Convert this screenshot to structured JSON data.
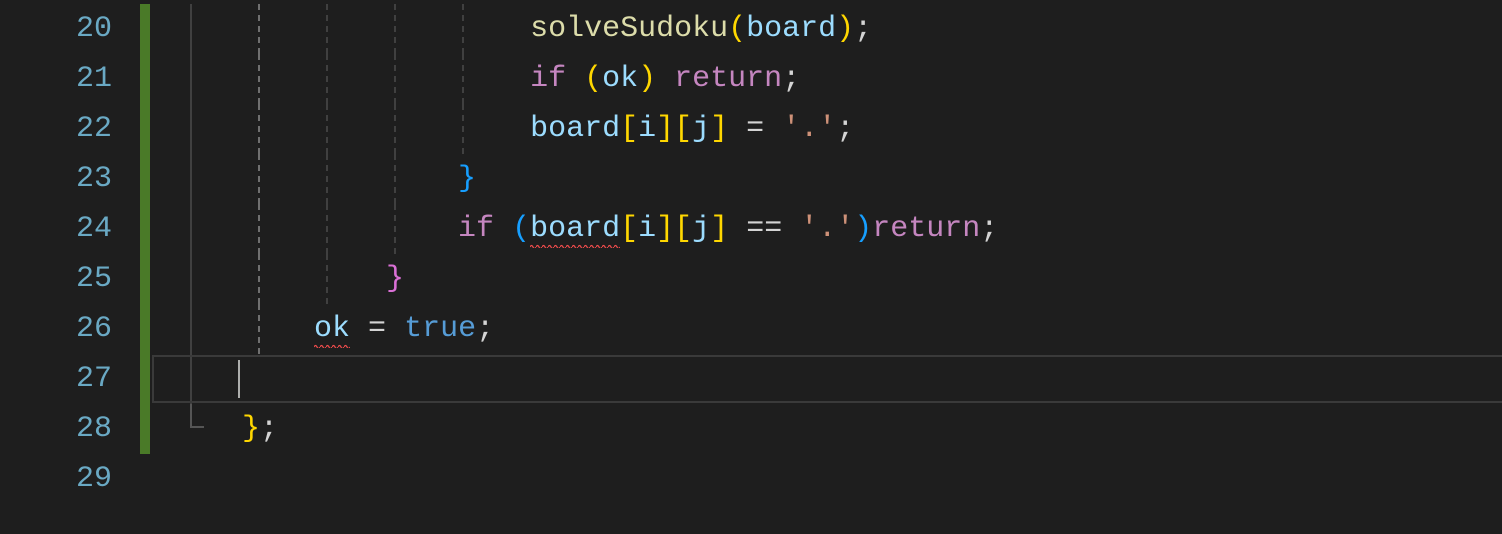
{
  "editor": {
    "language": "cpp",
    "currentLine": 27,
    "lines": [
      {
        "num": 20,
        "indent": 5,
        "guides": [
          0,
          1,
          2,
          3,
          4
        ],
        "activeGuide": 1,
        "tokens": [
          {
            "t": "solveSudoku",
            "c": "fn"
          },
          {
            "t": "(",
            "c": "paren-y"
          },
          {
            "t": "board",
            "c": "var"
          },
          {
            "t": ")",
            "c": "paren-y"
          },
          {
            "t": ";",
            "c": "punc"
          }
        ]
      },
      {
        "num": 21,
        "indent": 5,
        "guides": [
          0,
          1,
          2,
          3,
          4
        ],
        "activeGuide": 1,
        "tokens": [
          {
            "t": "if",
            "c": "kw"
          },
          {
            "t": " ",
            "c": "punc"
          },
          {
            "t": "(",
            "c": "paren-y"
          },
          {
            "t": "ok",
            "c": "var"
          },
          {
            "t": ")",
            "c": "paren-y"
          },
          {
            "t": " ",
            "c": "punc"
          },
          {
            "t": "return",
            "c": "kw"
          },
          {
            "t": ";",
            "c": "punc"
          }
        ]
      },
      {
        "num": 22,
        "indent": 5,
        "guides": [
          0,
          1,
          2,
          3,
          4
        ],
        "activeGuide": 1,
        "tokens": [
          {
            "t": "board",
            "c": "var"
          },
          {
            "t": "[",
            "c": "paren-y"
          },
          {
            "t": "i",
            "c": "var"
          },
          {
            "t": "]",
            "c": "paren-y"
          },
          {
            "t": "[",
            "c": "paren-y"
          },
          {
            "t": "j",
            "c": "var"
          },
          {
            "t": "]",
            "c": "paren-y"
          },
          {
            "t": " = ",
            "c": "punc"
          },
          {
            "t": "'.'",
            "c": "str"
          },
          {
            "t": ";",
            "c": "punc"
          }
        ]
      },
      {
        "num": 23,
        "indent": 4,
        "guides": [
          0,
          1,
          2,
          3
        ],
        "activeGuide": 1,
        "tokens": [
          {
            "t": "}",
            "c": "paren-b"
          }
        ]
      },
      {
        "num": 24,
        "indent": 4,
        "guides": [
          0,
          1,
          2,
          3
        ],
        "activeGuide": 1,
        "tokens": [
          {
            "t": "if",
            "c": "kw"
          },
          {
            "t": " ",
            "c": "punc"
          },
          {
            "t": "(",
            "c": "paren-b"
          },
          {
            "t": "board",
            "c": "var",
            "err": true
          },
          {
            "t": "[",
            "c": "paren-y"
          },
          {
            "t": "i",
            "c": "var"
          },
          {
            "t": "]",
            "c": "paren-y"
          },
          {
            "t": "[",
            "c": "paren-y"
          },
          {
            "t": "j",
            "c": "var"
          },
          {
            "t": "]",
            "c": "paren-y"
          },
          {
            "t": " == ",
            "c": "punc"
          },
          {
            "t": "'.'",
            "c": "str"
          },
          {
            "t": ")",
            "c": "paren-b"
          },
          {
            "t": "return",
            "c": "kw"
          },
          {
            "t": ";",
            "c": "punc"
          }
        ]
      },
      {
        "num": 25,
        "indent": 3,
        "guides": [
          0,
          1,
          2
        ],
        "activeGuide": 1,
        "tokens": [
          {
            "t": "}",
            "c": "paren-p"
          }
        ]
      },
      {
        "num": 26,
        "indent": 2,
        "guides": [
          0,
          1
        ],
        "activeGuide": 1,
        "tokens": [
          {
            "t": "ok",
            "c": "var",
            "err": true
          },
          {
            "t": " = ",
            "c": "punc"
          },
          {
            "t": "true",
            "c": "bool"
          },
          {
            "t": ";",
            "c": "punc"
          }
        ]
      },
      {
        "num": 27,
        "indent": 1,
        "guides": [
          0
        ],
        "activeGuide": -1,
        "current": true,
        "tokens": []
      },
      {
        "num": 28,
        "indent": 1,
        "guides": [],
        "activeGuide": -1,
        "corner": 0,
        "tokens": [
          {
            "t": "}",
            "c": "paren-y"
          },
          {
            "t": ";",
            "c": "punc"
          }
        ]
      },
      {
        "num": 29,
        "indent": 0,
        "guides": [],
        "activeGuide": -1,
        "tokens": []
      }
    ]
  },
  "style": {
    "charWidth": 17,
    "indentChars": 4,
    "codeLeft": 170
  }
}
